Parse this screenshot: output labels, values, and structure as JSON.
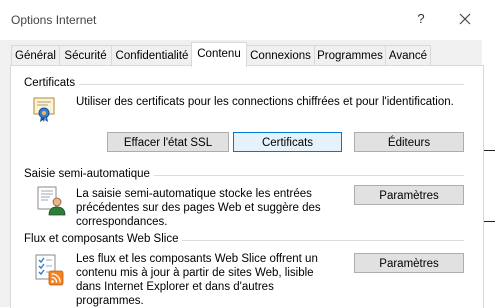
{
  "window": {
    "title": "Options Internet",
    "help_glyph": "?",
    "close_icon": "close-icon"
  },
  "tabs": [
    {
      "label": "Général",
      "active": false
    },
    {
      "label": "Sécurité",
      "active": false
    },
    {
      "label": "Confidentialité",
      "active": false
    },
    {
      "label": "Contenu",
      "active": true
    },
    {
      "label": "Connexions",
      "active": false
    },
    {
      "label": "Programmes",
      "active": false
    },
    {
      "label": "Avancé",
      "active": false
    }
  ],
  "certificates": {
    "label": "Certificats",
    "description": "Utiliser des certificats pour les connections chiffrées et pour l'identification.",
    "icon": "certificate-icon",
    "buttons": {
      "clear_ssl": "Effacer l'état SSL",
      "certificates": "Certificats",
      "publishers": "Éditeurs"
    }
  },
  "autocomplete": {
    "label": "Saisie semi-automatique",
    "description": "La saisie semi-automatique stocke les entrées précédentes sur des pages Web et suggère des correspondances.",
    "icon": "autocomplete-user-icon",
    "button": "Paramètres"
  },
  "feeds": {
    "label": "Flux et composants Web Slice",
    "description": "Les flux et les composants Web Slice offrent un contenu mis à jour à partir de sites Web, lisible dans Internet Explorer et dans d'autres programmes.",
    "icon": "feeds-icon",
    "button": "Paramètres"
  },
  "colors": {
    "accent": "#0078d7",
    "panel_bg": "#ffffff",
    "dialog_bg": "#f0f0f0"
  }
}
